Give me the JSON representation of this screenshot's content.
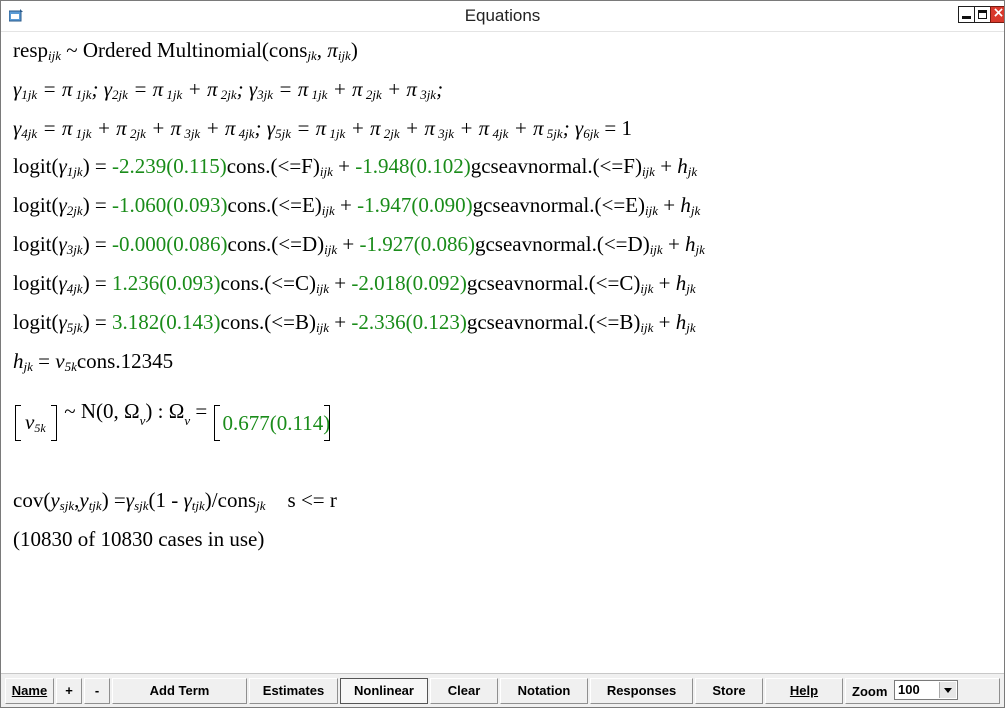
{
  "window": {
    "title": "Equations",
    "close_glyph": "×"
  },
  "equations": {
    "resp": "resp",
    "resp_sub": "ijk",
    "resp_rest": " ~ Ordered Multinomial(cons",
    "resp_sub2": "jk",
    "resp_mid": ", ",
    "pi": "π",
    "pi_sub": "ijk",
    "resp_end": ")",
    "gamma": "γ",
    "cons_word": "cons",
    "gcse_word": "gcseavnormal",
    "logit_word": "logit",
    "rows": [
      {
        "k": "1",
        "cat": "F",
        "c1": "-2.239(0.115)",
        "c2": "-1.948(0.102)"
      },
      {
        "k": "2",
        "cat": "E",
        "c1": "-1.060(0.093)",
        "c2": "-1.947(0.090)"
      },
      {
        "k": "3",
        "cat": "D",
        "c1": "-0.000(0.086)",
        "c2": "-1.927(0.086)"
      },
      {
        "k": "4",
        "cat": "C",
        "c1": "1.236(0.093)",
        "c2": "-2.018(0.092)"
      },
      {
        "k": "5",
        "cat": "B",
        "c1": "3.182(0.143)",
        "c2": "-2.336(0.123)"
      }
    ],
    "h": "h",
    "h_sub": "jk",
    "h_rest": " = ",
    "v": "v",
    "v_sub": "5k",
    "h_cons": "cons.12345",
    "dist": " ~ N(0,  Ω",
    "dist_sub": "v",
    "dist_mid": ")  :  Ω",
    "omega_val": "0.677(0.114)",
    "cov_text": "cov(",
    "cov_y": "y",
    "cov_s": "sjk",
    "cov_t": "tjk",
    "cov_mid": ") =",
    "cov_tail": "(1 - ",
    "cov_end": ")/cons",
    "cov_cond": "s <= r",
    "cases": "(10830 of 10830 cases in use)"
  },
  "toolbar": {
    "buttons": [
      "Name",
      "+",
      "-",
      "Add Term",
      "Estimates",
      "Nonlinear",
      "Clear",
      "Notation",
      "Responses",
      "Store",
      "Help"
    ],
    "zoom_label": "Zoom",
    "zoom_value": "100"
  },
  "colors": {
    "estimate_green": "#1a8c1a",
    "close_red": "#d9392c"
  }
}
